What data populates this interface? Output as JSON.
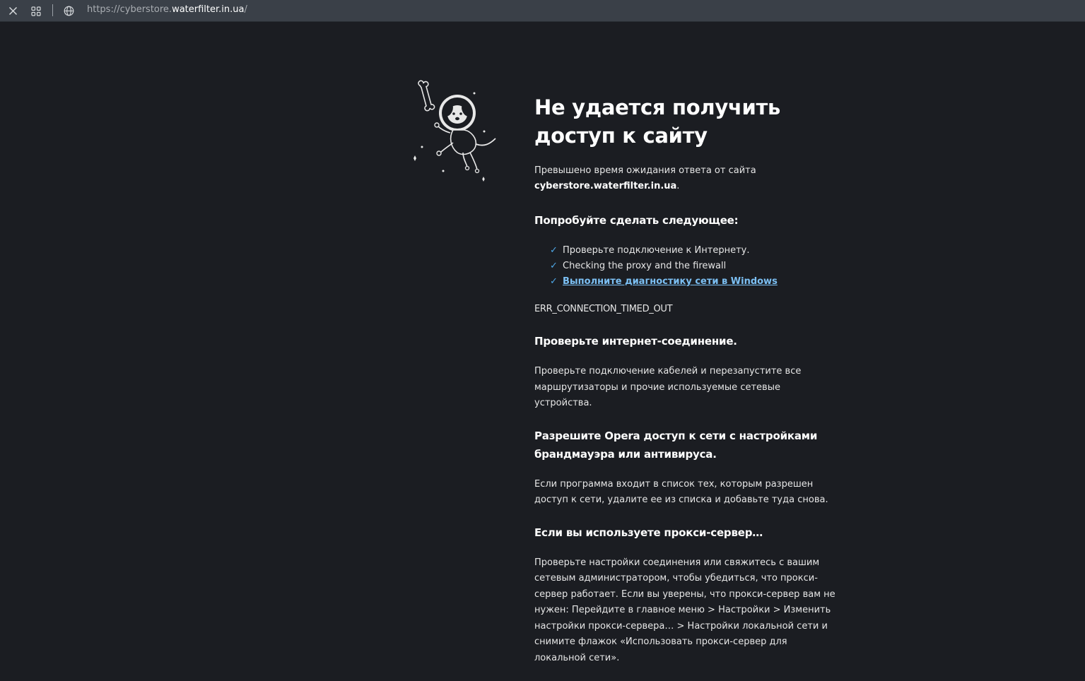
{
  "browser": {
    "url_scheme": "https://",
    "url_subdomain": "cyberstore.",
    "url_main": "waterfilter.in.ua",
    "url_path": "/"
  },
  "error_page": {
    "title": "Не удается получить доступ к сайту",
    "description_prefix": "Превышено время ожидания ответа от сайта",
    "description_host": "cyberstore.waterfilter.in.ua",
    "description_suffix": ".",
    "try_heading": "Попробуйте сделать следующее:",
    "tips": [
      "Проверьте подключение к Интернету.",
      "Checking the proxy and the firewall",
      "Выполните диагностику сети в Windows"
    ],
    "error_code": "ERR_CONNECTION_TIMED_OUT",
    "sections": [
      {
        "heading": "Проверьте интернет-соединение.",
        "body": "Проверьте подключение кабелей и перезапустите все маршрутизаторы и прочие используемые сетевые устройства."
      },
      {
        "heading": "Разрешите Opera доступ к сети с настройками брандмауэра или антивируса.",
        "body": "Если программа входит в список тех, которым разрешен доступ к сети, удалите ее из списка и добавьте туда снова."
      },
      {
        "heading": "Если вы используете прокси-сервер…",
        "body": "Проверьте настройки соединения или свяжитесь с вашим сетевым администратором, чтобы убедиться, что прокси-сервер работает. Если вы уверены, что прокси-сервер вам не нужен: Перейдите в главное меню > Настройки > Изменить настройки прокси-сервера… > Настройки локальной сети и снимите флажок «Использовать прокси-сервер для локальной сети»."
      }
    ]
  },
  "icons": {
    "close": "close-icon",
    "tabs": "tabs-grid-icon",
    "globe": "globe-icon",
    "check": "checkmark-icon",
    "illustration": "astronaut-dog-illustration"
  },
  "colors": {
    "page_bg": "#1b1d22",
    "topbar_bg": "#3a4048",
    "link": "#7cc0f4",
    "check": "#4ea8e8"
  }
}
